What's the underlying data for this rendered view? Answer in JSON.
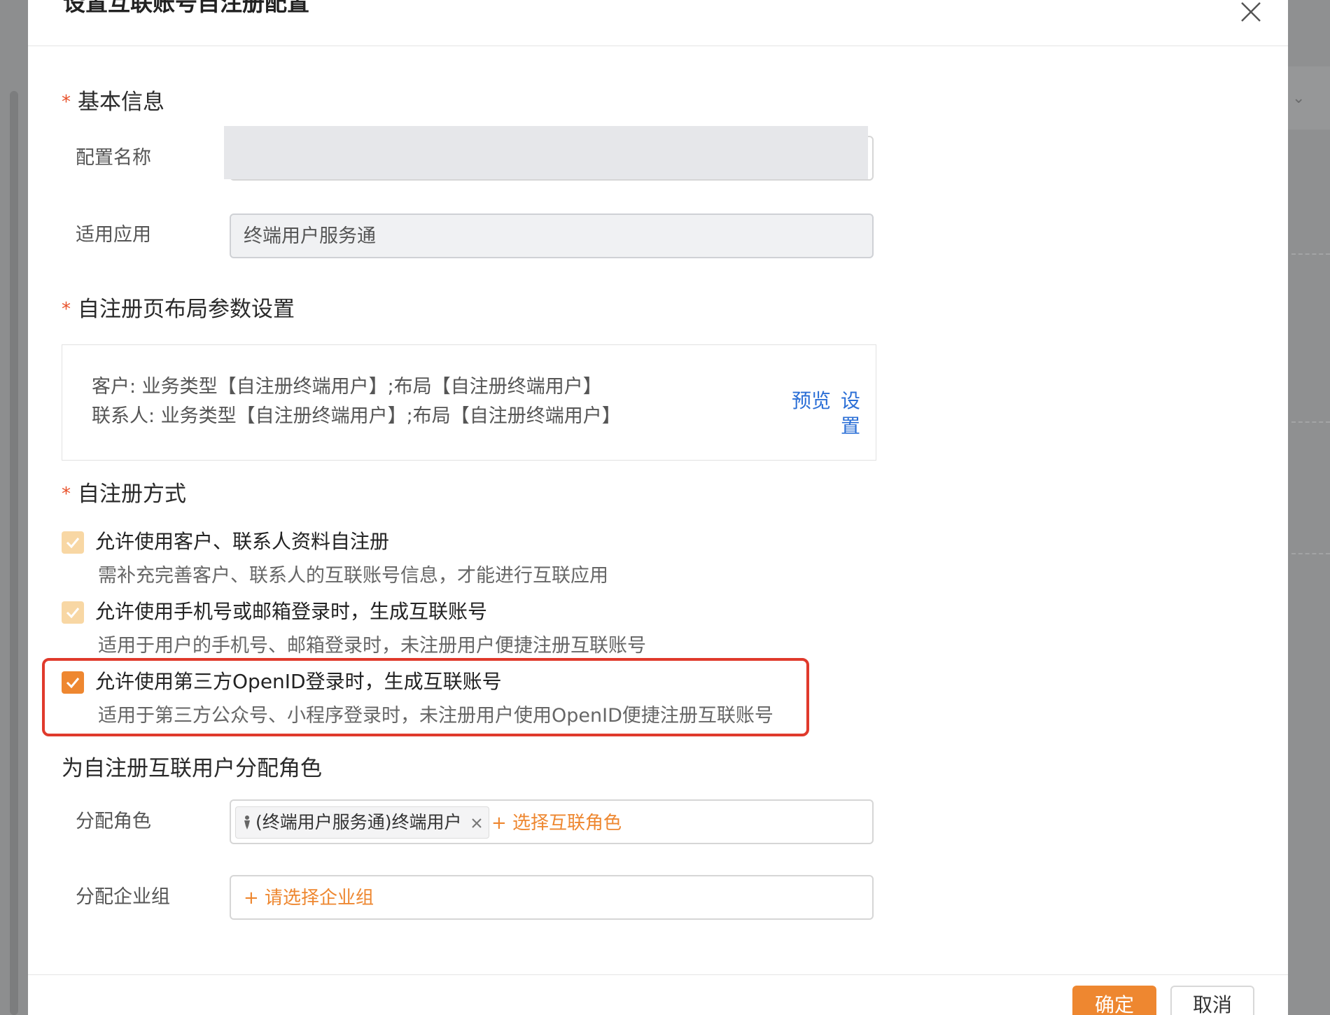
{
  "dialog": {
    "title": "设置互联账号自注册配置"
  },
  "basic_info": {
    "title": "基本信息",
    "config_name_label": "配置名称",
    "app_label": "适用应用",
    "app_value": "终端用户服务通"
  },
  "layout_settings": {
    "title": "自注册页布局参数设置",
    "line1": "客户: 业务类型【自注册终端用户】;布局【自注册终端用户】",
    "line2": "联系人: 业务类型【自注册终端用户】;布局【自注册终端用户】",
    "preview_label": "预览",
    "settings_label": "设置"
  },
  "register_methods": {
    "title": "自注册方式",
    "options": [
      {
        "label": "允许使用客户、联系人资料自注册",
        "desc": "需补充完善客户、联系人的互联账号信息，才能进行互联应用",
        "checked": true,
        "enabled": false
      },
      {
        "label": "允许使用手机号或邮箱登录时，生成互联账号",
        "desc": "适用于用户的手机号、邮箱登录时，未注册用户便捷注册互联账号",
        "checked": true,
        "enabled": false
      },
      {
        "label": "允许使用第三方OpenID登录时，生成互联账号",
        "desc": "适用于第三方公众号、小程序登录时，未注册用户使用OpenID便捷注册互联账号",
        "checked": true,
        "enabled": true
      }
    ]
  },
  "role_assign": {
    "title": "为自注册互联用户分配角色",
    "role_label": "分配角色",
    "role_tag": "(终端用户服务通)终端用户",
    "add_role": "+ 选择互联角色",
    "group_label": "分配企业组",
    "add_group": "+ 请选择企业组"
  },
  "footer": {
    "confirm": "确定",
    "cancel": "取消"
  },
  "colors": {
    "accent": "#ee8730",
    "checkbox_disabled": "#f8d7a4",
    "link": "#2b6fd6",
    "required": "#e8512a",
    "highlight": "#e03a2c"
  }
}
